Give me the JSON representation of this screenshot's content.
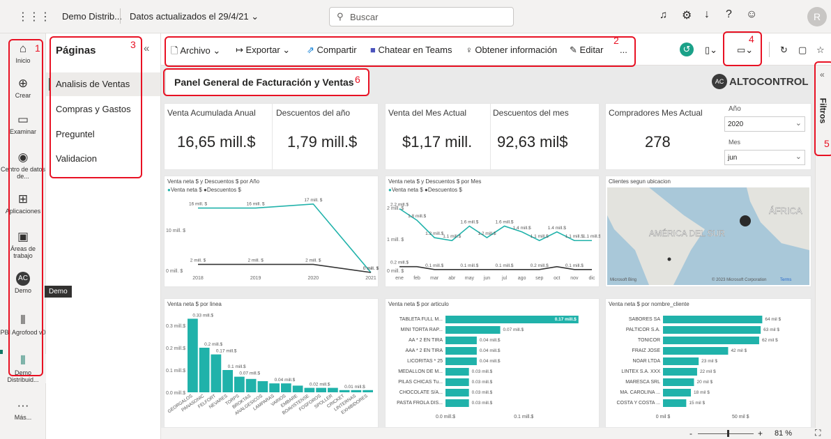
{
  "topbar": {
    "app_name": "Demo Distrib...",
    "data_updated": "Datos actualizados el 29/4/21",
    "search_placeholder": "Buscar",
    "avatar": "R"
  },
  "nav": {
    "items": [
      {
        "label": "Inicio"
      },
      {
        "label": "Crear"
      },
      {
        "label": "Examinar"
      },
      {
        "label": "Centro de datos de..."
      },
      {
        "label": "Aplicaciones"
      },
      {
        "label": "Áreas de trabajo"
      },
      {
        "label": "Demo"
      },
      {
        "label": "PBI Agrofood v0"
      },
      {
        "label": "Demo Distribuid..."
      },
      {
        "label": "Más..."
      }
    ],
    "tooltip": "Demo"
  },
  "pages": {
    "title": "Páginas",
    "items": [
      "Analisis de Ventas",
      "Compras y Gastos",
      "Preguntel",
      "Validacion"
    ]
  },
  "toolbar": {
    "archivo": "Archivo",
    "exportar": "Exportar",
    "compartir": "Compartir",
    "teams": "Chatear en Teams",
    "insights": "Obtener información",
    "editar": "Editar",
    "more": "..."
  },
  "annotations": [
    "1",
    "2",
    "3",
    "4",
    "5",
    "6"
  ],
  "report": {
    "title": "Panel General de Facturación y Ventas",
    "logo": "ALTOCONTROL",
    "kpis": [
      {
        "label": "Venta Acumulada Anual",
        "value": "16,65 mill.$"
      },
      {
        "label": "Descuentos del año",
        "value": "1,79 mill.$"
      },
      {
        "label": "Venta del Mes Actual",
        "value": "$1,17 mill."
      },
      {
        "label": "Descuentos del mes",
        "value": "92,63 mil$"
      },
      {
        "label": "Compradores Mes Actual",
        "value": "278"
      }
    ],
    "slicers": {
      "year_label": "Año",
      "year_value": "2020",
      "month_label": "Mes",
      "month_value": "jun"
    },
    "filters_label": "Filtros",
    "zoom": "81 %"
  },
  "chart_data": [
    {
      "type": "line",
      "title": "Venta neta $ y Descuentos $ por Año",
      "legend": [
        "Venta neta $",
        "Descuentos $"
      ],
      "x": [
        "2018",
        "2019",
        "2020",
        "2021"
      ],
      "series": [
        {
          "name": "Venta neta $",
          "values": [
            16,
            16,
            17,
            0
          ],
          "labels": [
            "16 mill. $",
            "16 mill. $",
            "17 mill. $",
            "0 mill. $"
          ],
          "color": "#20b2aa"
        },
        {
          "name": "Descuentos $",
          "values": [
            2,
            2,
            2,
            0
          ],
          "labels": [
            "2 mill. $",
            "2 mill. $",
            "2 mill. $",
            "0 mill. $"
          ],
          "color": "#333333"
        }
      ],
      "yticks": [
        "10 mill. $",
        "0 mill. $"
      ]
    },
    {
      "type": "line",
      "title": "Venta neta $ y Descuentos $ por Mes",
      "legend": [
        "Venta neta $",
        "Descuentos $"
      ],
      "x": [
        "ene",
        "feb",
        "mar",
        "abr",
        "may",
        "jun",
        "jul",
        "ago",
        "sep",
        "oct",
        "nov",
        "dic"
      ],
      "series": [
        {
          "name": "Venta neta $",
          "values": [
            2.2,
            1.8,
            1.2,
            1.1,
            1.6,
            1.2,
            1.6,
            1.4,
            1.1,
            1.4,
            1.1,
            1.1
          ],
          "labels": [
            "2.2 mill.$",
            "1.8 mill.$",
            "1.2 mill.$",
            "1.1 mill.$",
            "1.6 mill.$",
            "1.2 mill.$",
            "1.6 mill.$",
            "1.4 mill.$",
            "1.1 mill.$",
            "1.4 mill.$",
            "1.1 mill.$",
            "1.1 mill.$"
          ],
          "color": "#20b2aa"
        },
        {
          "name": "Descuentos $",
          "values": [
            0.2,
            0.2,
            0.1,
            0.1,
            0.1,
            0.1,
            0.1,
            0.1,
            0.1,
            0.2,
            0.1,
            0.1
          ],
          "labels": [
            "0.2 mill.$",
            "",
            "0.1 mill.$",
            "",
            "0.1 mill.$",
            "",
            "0.1 mill.$",
            "",
            "0.2 mill.$",
            "",
            "0.1 mill.$",
            ""
          ],
          "color": "#333333"
        }
      ],
      "yticks": [
        "2 mill. $",
        "1 mill. $",
        "0 mill. $"
      ]
    },
    {
      "type": "map",
      "title": "Clientes segun ubicacion",
      "labels": [
        "AMÉRICA DEL SUR",
        "ÁFRICA"
      ],
      "credit": "© 2023 Microsoft Corporation",
      "terms": "Terms",
      "brand": "Microsoft Bing"
    },
    {
      "type": "bar",
      "title": "Venta neta $ por linea",
      "categories": [
        "GEORGALOS",
        "PANASONIC",
        "FELFORT",
        "NEVARES",
        "TORPS",
        "BROKTAS",
        "ANALGESICOS",
        "LAMPARAS",
        "VARIOS",
        "EMBARE",
        "BOAVISTENSE",
        "FOSFOROS",
        "SPOLLER",
        "CRICKET",
        "LINTERNAS",
        "EXHIBIDORES"
      ],
      "values": [
        0.33,
        0.2,
        0.17,
        0.1,
        0.07,
        0.06,
        0.05,
        0.04,
        0.04,
        0.03,
        0.02,
        0.02,
        0.02,
        0.01,
        0.01,
        0.01
      ],
      "labels": [
        "0.33 mill.$",
        "0.2 mill.$",
        "0.17 mill.$",
        "0.1 mill.$",
        "0.07 mill.$",
        "",
        "",
        "0.04 mill.$",
        "",
        "",
        "0.02 mill.$",
        "",
        "",
        "0.01 mill.$",
        "",
        ""
      ],
      "yticks": [
        "0.3 mill.$",
        "0.2 mill.$",
        "0.1 mill.$",
        "0.0 mill.$"
      ]
    },
    {
      "type": "bar",
      "orientation": "horizontal",
      "title": "Venta neta $ por articulo",
      "categories": [
        "TABLETA FULL M...",
        "MINI TORTA RAP...",
        "AA * 2 EN TIRA",
        "AAA * 2 EN TIRA",
        "LICORITAS * 25",
        "MEDALLON DE M...",
        "PILAS CHICAS Tu...",
        "CHOCOLATE S/A...",
        "PASTA FROLA DIS..."
      ],
      "values": [
        0.17,
        0.07,
        0.04,
        0.04,
        0.04,
        0.03,
        0.03,
        0.03,
        0.03
      ],
      "labels": [
        "0.17 mill.$",
        "0.07 mill.$",
        "0.04 mill.$",
        "0.04 mill.$",
        "0.04 mill.$",
        "0.03 mill.$",
        "0.03 mill.$",
        "0.03 mill.$",
        "0.03 mill.$"
      ],
      "xticks": [
        "0.0 mill.$",
        "0.1 mill.$"
      ]
    },
    {
      "type": "bar",
      "orientation": "horizontal",
      "title": "Venta neta $ por nombre_cliente",
      "categories": [
        "SABORES SA",
        "PALTICOR S.A.",
        "TONICOR",
        "FRAIZ JOSE",
        "NOAR LTDA",
        "LINTEX S.A. XXX",
        "MARESCA SRL",
        "MA. CAROLINA ...",
        "COSTA Y COSTA ..."
      ],
      "values": [
        64,
        63,
        62,
        42,
        23,
        22,
        20,
        18,
        15
      ],
      "labels": [
        "64 mil $",
        "63 mil $",
        "62 mil $",
        "42 mil $",
        "23 mil $",
        "22 mil $",
        "20 mil $",
        "18 mil $",
        "15 mil $"
      ],
      "xticks": [
        "0 mil $",
        "50 mil $"
      ]
    }
  ]
}
